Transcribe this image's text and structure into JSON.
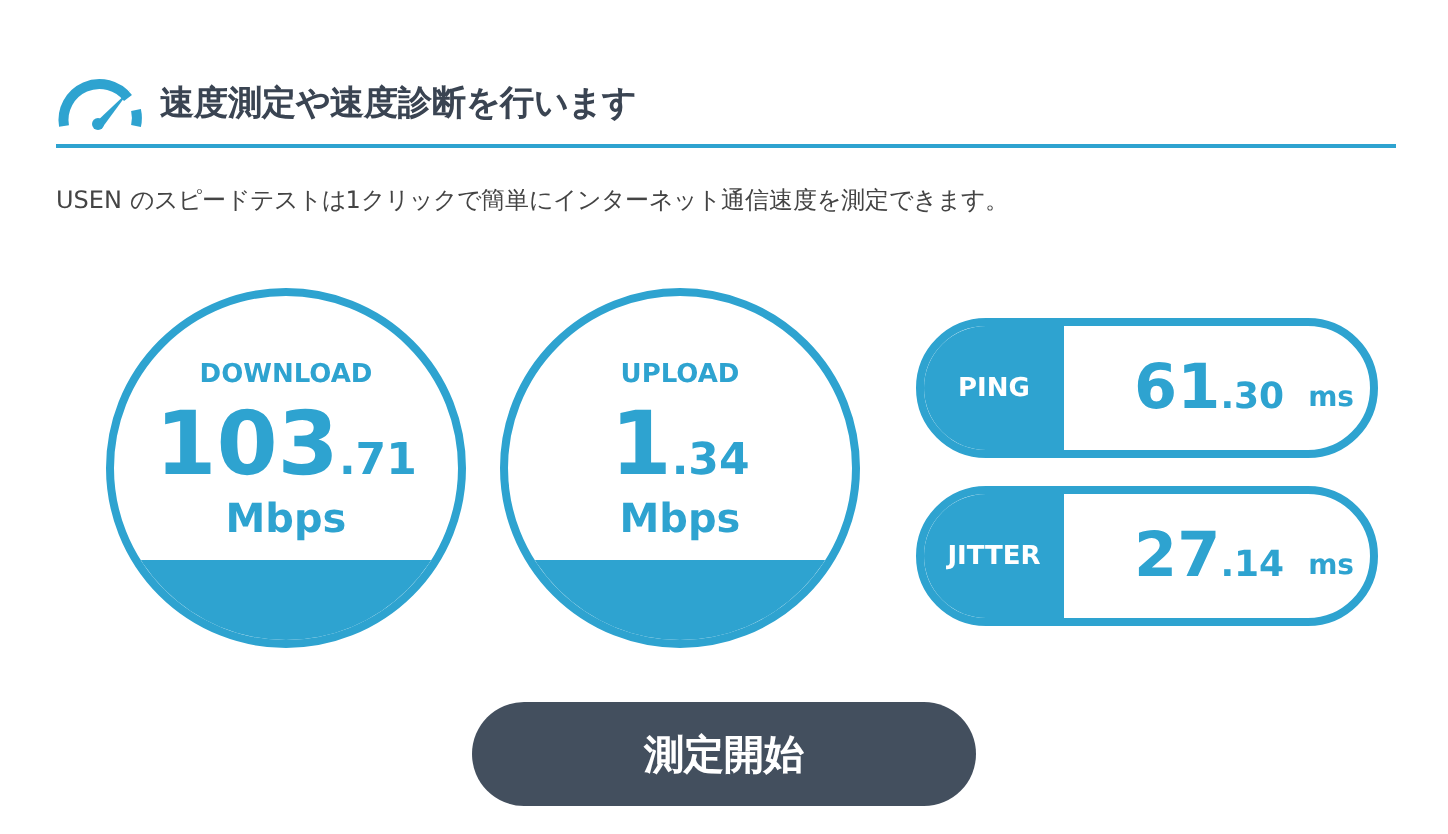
{
  "header": {
    "title": "速度測定や速度診断を行います"
  },
  "description": "USEN のスピードテストは1クリックで簡単にインターネット通信速度を測定できます。",
  "speeds": [
    {
      "label": "DOWNLOAD",
      "value": "103",
      "decimal": ".71",
      "unit": "Mbps"
    },
    {
      "label": "UPLOAD",
      "value": "1",
      "decimal": ".34",
      "unit": "Mbps"
    }
  ],
  "latency": [
    {
      "label": "PING",
      "value": "61",
      "decimal": ".30",
      "unit": "ms"
    },
    {
      "label": "JITTER",
      "value": "27",
      "decimal": ".14",
      "unit": "ms"
    }
  ],
  "start_button": "測定開始"
}
